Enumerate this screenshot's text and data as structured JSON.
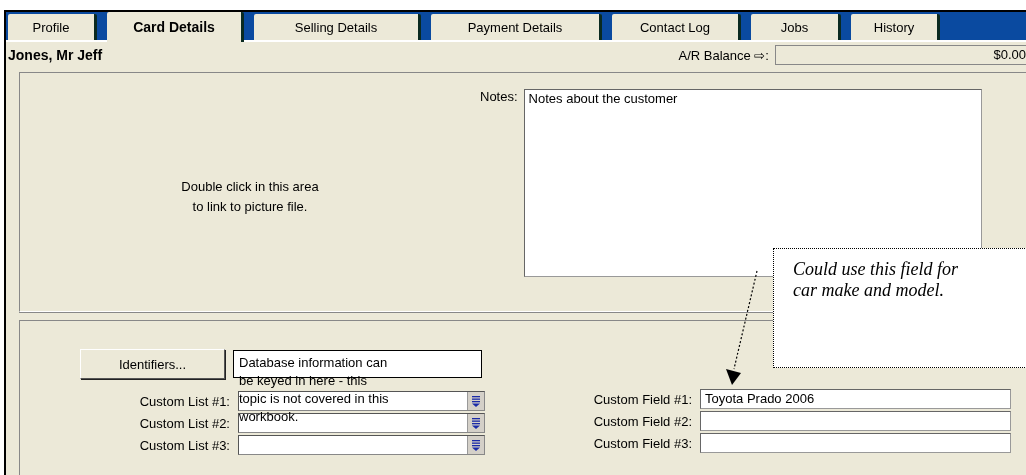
{
  "tabs": [
    {
      "label": "Profile",
      "selected": false
    },
    {
      "label": "Card Details",
      "selected": true
    },
    {
      "label": "Selling Details",
      "selected": false
    },
    {
      "label": "Payment Details",
      "selected": false
    },
    {
      "label": "Contact Log",
      "selected": false
    },
    {
      "label": "Jobs",
      "selected": false
    },
    {
      "label": "History",
      "selected": false
    }
  ],
  "card_name": "Jones, Mr Jeff",
  "balance": {
    "label": "A/R Balance ⇨:",
    "value": "$0.00"
  },
  "picture_hint": "Double click in this area\nto link to picture file.",
  "notes": {
    "label": "Notes:",
    "value": "Notes about the customer"
  },
  "identifiers_button": "Identifiers...",
  "custom_lists": [
    {
      "label": "Custom List #1:"
    },
    {
      "label": "Custom List #2:"
    },
    {
      "label": "Custom List #3:"
    }
  ],
  "custom_fields": [
    {
      "label": "Custom Field #1:",
      "value": "Toyota Prado 2006"
    },
    {
      "label": "Custom Field #2:"
    },
    {
      "label": "Custom Field #3:"
    }
  ],
  "annotations": [
    {
      "kind": "overlay",
      "text": "Database information can\nbe keyed in here - this\ntopic is not covered in this\nworkbook."
    },
    {
      "kind": "callout",
      "text": "Could use this field for car make and model."
    }
  ]
}
